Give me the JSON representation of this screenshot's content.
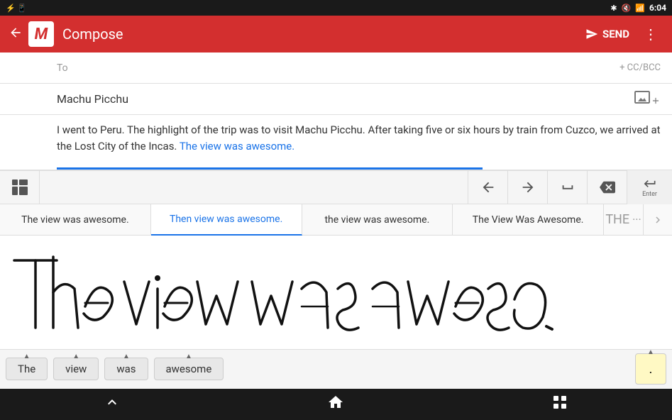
{
  "statusBar": {
    "time": "6:04",
    "icons": [
      "bluetooth",
      "signal",
      "wifi",
      "battery"
    ]
  },
  "appBar": {
    "title": "Compose",
    "sendLabel": "SEND",
    "backIcon": "‹",
    "gmailLetter": "M",
    "moreIcon": "⋮"
  },
  "compose": {
    "toLabel": "To",
    "ccBccLabel": "+ CC/BCC",
    "subject": "Machu Picchu",
    "bodyText": "I went to Peru. The highlight of the trip was to visit Machu Picchu. After taking five or six hours by train from Cuzco, we arrived at the Lost City of the Incas. ",
    "highlightedText": "The view was awesome.",
    "attachIcon": "🖼"
  },
  "suggestions": [
    {
      "label": "The view was awesome.",
      "active": false
    },
    {
      "label": "Then view was awesome.",
      "active": true
    },
    {
      "label": "the view was awesome.",
      "active": false
    },
    {
      "label": "The View Was Awesome.",
      "active": false
    },
    {
      "label": "THE",
      "active": false
    }
  ],
  "wordCandidates": [
    {
      "label": "The",
      "hasArrow": true
    },
    {
      "label": "view",
      "hasArrow": true
    },
    {
      "label": "was",
      "hasArrow": true
    },
    {
      "label": "awesome",
      "hasArrow": true
    }
  ],
  "periodBtn": ".",
  "navBar": {
    "backIcon": "⌄",
    "homeIcon": "⬡",
    "recentIcon": "▣"
  },
  "hwToolbar": {
    "gridIcon": "⊞",
    "backArrow": "←",
    "forwardArrow": "→",
    "spaceIcon": "⎵",
    "deleteIcon": "⌫",
    "enterLabel": "Enter"
  }
}
